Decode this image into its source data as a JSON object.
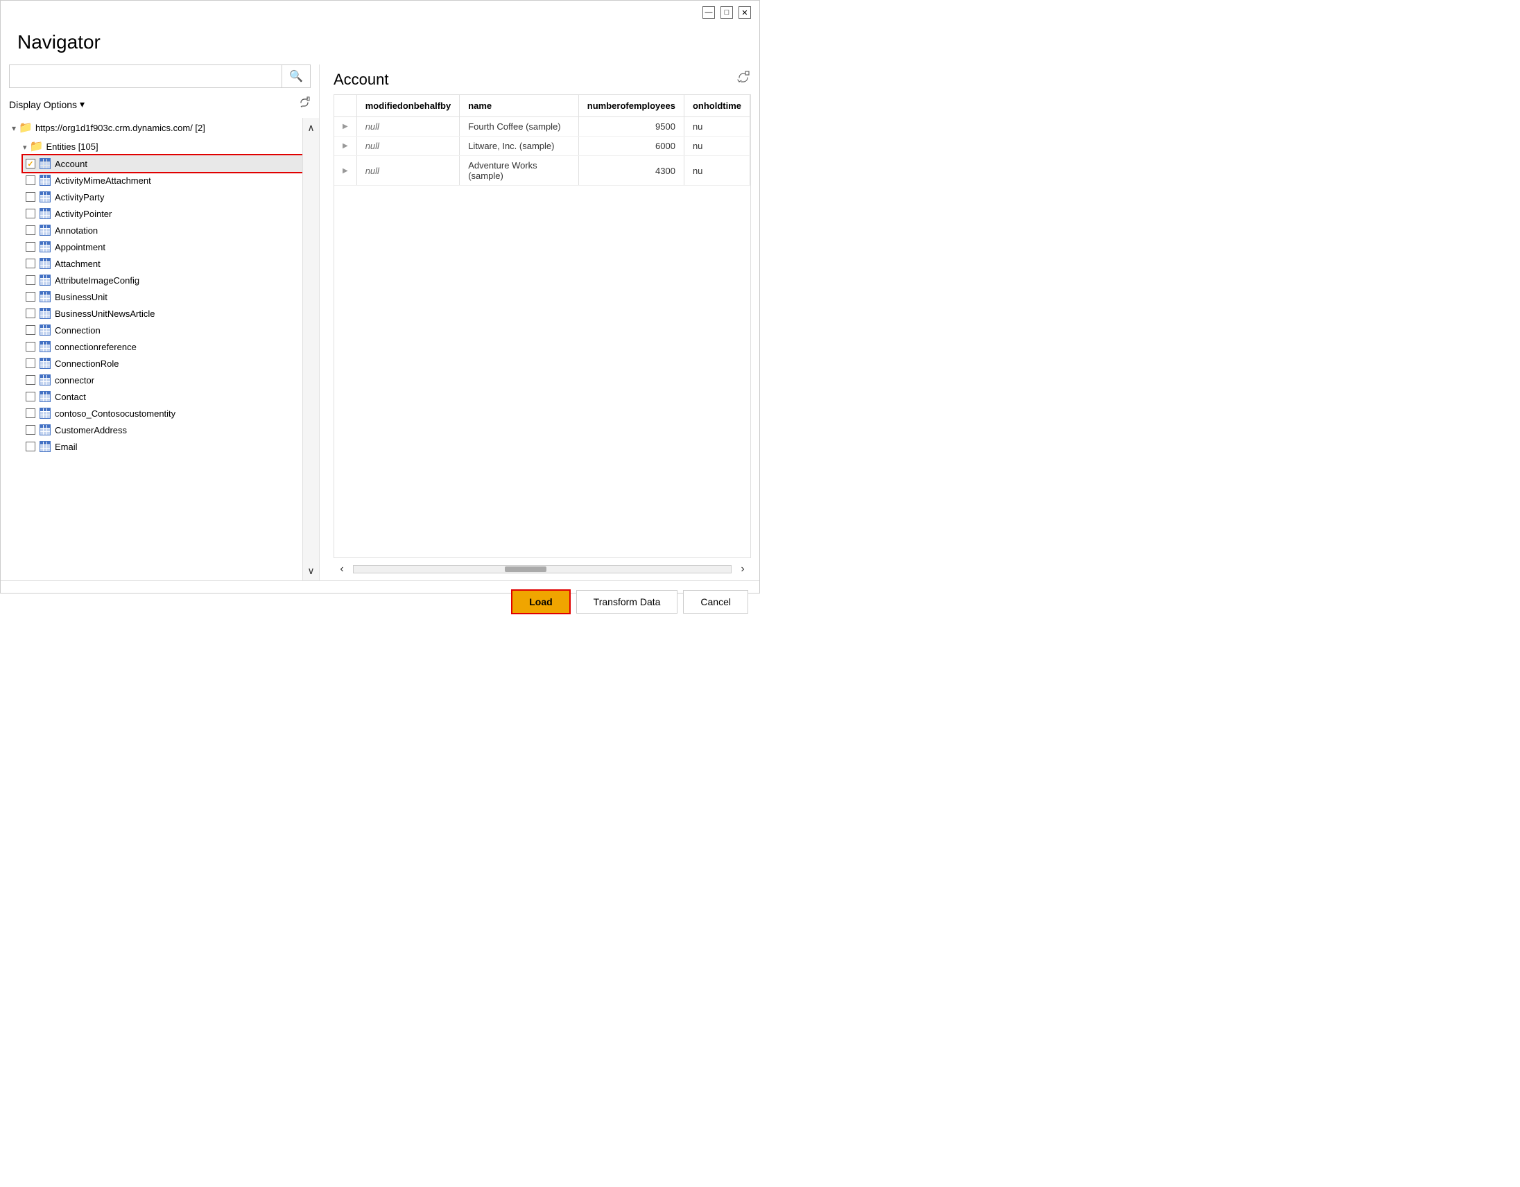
{
  "window": {
    "title": "Navigator",
    "minimize_label": "—",
    "maximize_label": "□",
    "close_label": "✕"
  },
  "search": {
    "placeholder": ""
  },
  "display_options": {
    "label": "Display Options",
    "dropdown_icon": "▾"
  },
  "tree": {
    "root": {
      "url": "https://org1d1f903c.crm.dynamics.com/ [2]"
    },
    "entities_group": "Entities [105]",
    "items": [
      {
        "label": "Account",
        "checked": true
      },
      {
        "label": "ActivityMimeAttachment",
        "checked": false
      },
      {
        "label": "ActivityParty",
        "checked": false
      },
      {
        "label": "ActivityPointer",
        "checked": false
      },
      {
        "label": "Annotation",
        "checked": false
      },
      {
        "label": "Appointment",
        "checked": false
      },
      {
        "label": "Attachment",
        "checked": false
      },
      {
        "label": "AttributeImageConfig",
        "checked": false
      },
      {
        "label": "BusinessUnit",
        "checked": false
      },
      {
        "label": "BusinessUnitNewsArticle",
        "checked": false
      },
      {
        "label": "Connection",
        "checked": false
      },
      {
        "label": "connectionreference",
        "checked": false
      },
      {
        "label": "ConnectionRole",
        "checked": false
      },
      {
        "label": "connector",
        "checked": false
      },
      {
        "label": "Contact",
        "checked": false
      },
      {
        "label": "contoso_Contosocustomentity",
        "checked": false
      },
      {
        "label": "CustomerAddress",
        "checked": false
      },
      {
        "label": "Email",
        "checked": false
      }
    ]
  },
  "right_panel": {
    "title": "Account",
    "columns": [
      {
        "id": "modifiedonbehalfby",
        "label": "modifiedonbehalfby"
      },
      {
        "id": "name",
        "label": "name"
      },
      {
        "id": "numberofemployees",
        "label": "numberofemployees"
      },
      {
        "id": "onholdtime",
        "label": "onholdtime"
      }
    ],
    "rows": [
      {
        "modifiedonbehalfby": "null",
        "name": "Fourth Coffee (sample)",
        "numberofemployees": "9500",
        "onholdtime": "nu"
      },
      {
        "modifiedonbehalfby": "null",
        "name": "Litware, Inc. (sample)",
        "numberofemployees": "6000",
        "onholdtime": "nu"
      },
      {
        "modifiedonbehalfby": "null",
        "name": "Adventure Works (sample)",
        "numberofemployees": "4300",
        "onholdtime": "nu"
      }
    ]
  },
  "buttons": {
    "load": "Load",
    "transform": "Transform Data",
    "cancel": "Cancel"
  }
}
